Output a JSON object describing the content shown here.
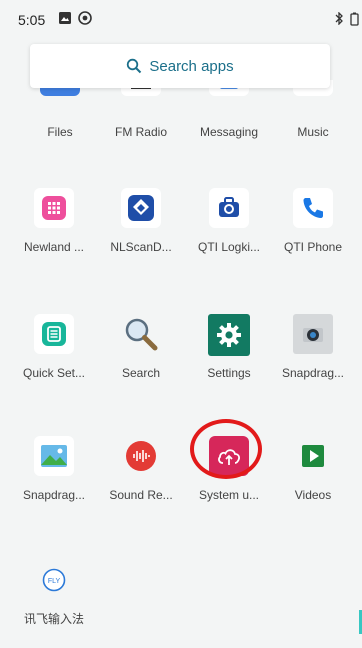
{
  "status_bar": {
    "time": "5:05",
    "icons": [
      "image-icon",
      "sync-icon",
      "bluetooth-icon",
      "battery-icon"
    ]
  },
  "search": {
    "label": "Search apps",
    "icon": "search-icon"
  },
  "apps": [
    {
      "label": "Files",
      "icon": "files-icon"
    },
    {
      "label": "FM Radio",
      "icon": "fm-radio-icon"
    },
    {
      "label": "Messaging",
      "icon": "messaging-icon"
    },
    {
      "label": "Music",
      "icon": "music-icon"
    },
    {
      "label": "Newland ...",
      "icon": "newland-icon"
    },
    {
      "label": "NLScanD...",
      "icon": "nlscan-icon"
    },
    {
      "label": "QTI Logki...",
      "icon": "qti-logkit-icon"
    },
    {
      "label": "QTI Phone",
      "icon": "phone-icon"
    },
    {
      "label": "Quick Set...",
      "icon": "quick-settings-icon"
    },
    {
      "label": "Search",
      "icon": "magnifier-icon"
    },
    {
      "label": "Settings",
      "icon": "settings-gear-icon"
    },
    {
      "label": "Snapdrag...",
      "icon": "camera-icon"
    },
    {
      "label": "Snapdrag...",
      "icon": "gallery-icon"
    },
    {
      "label": "Sound Re...",
      "icon": "sound-recorder-icon"
    },
    {
      "label": "System u...",
      "icon": "system-update-icon"
    },
    {
      "label": "Videos",
      "icon": "videos-play-icon"
    },
    {
      "label": "讯飞输入法",
      "icon": "iflytek-icon",
      "icon_text": "FLY"
    }
  ],
  "colors": {
    "highlight": "#e21a1a",
    "search_text": "#1b6f8a"
  }
}
